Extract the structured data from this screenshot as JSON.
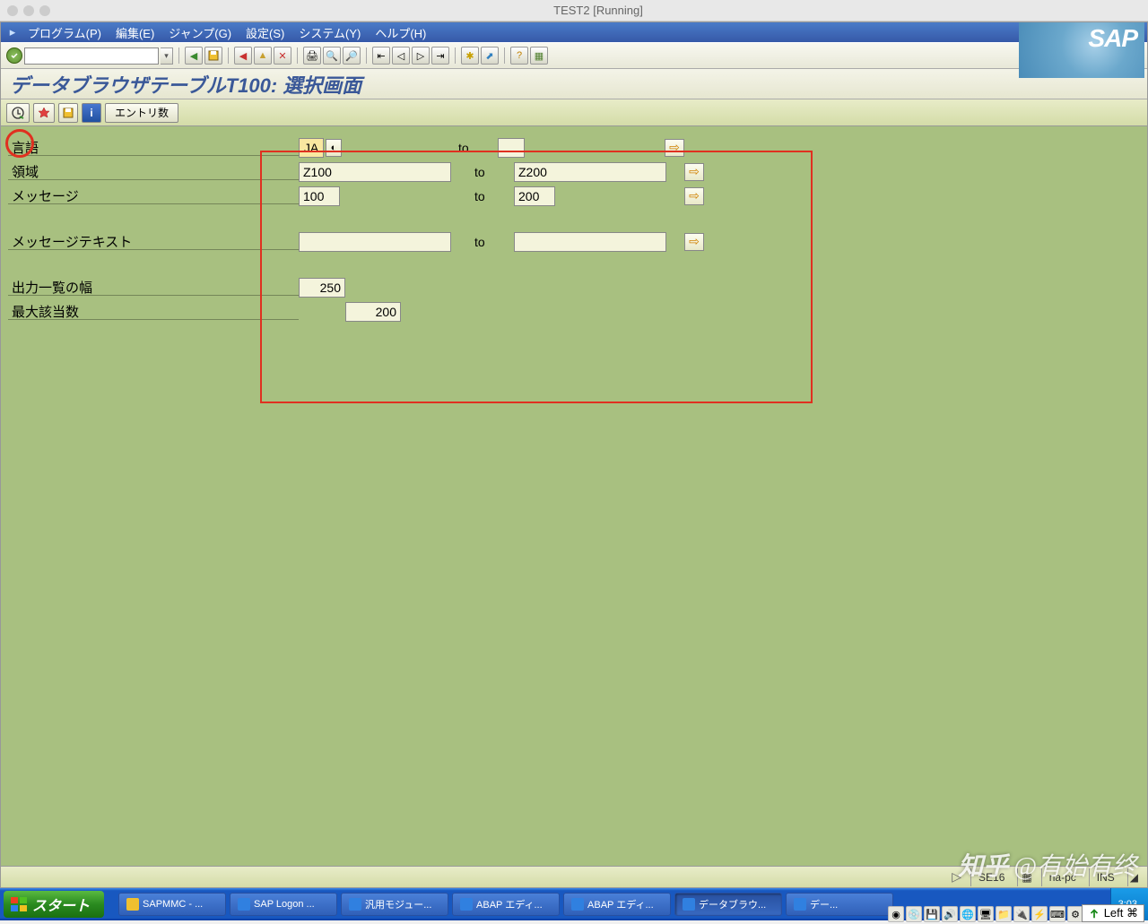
{
  "window": {
    "title": "TEST2 [Running]"
  },
  "menubar": {
    "items": [
      "プログラム(P)",
      "編集(E)",
      "ジャンプ(G)",
      "設定(S)",
      "システム(Y)",
      "ヘルプ(H)"
    ]
  },
  "sap_logo": "SAP",
  "page_title": "データブラウザテーブルT100: 選択画面",
  "app_toolbar": {
    "entry_count_btn": "エントリ数"
  },
  "selection": {
    "rows": [
      {
        "label": "言語",
        "from": "JA",
        "to": "",
        "has_f4": true,
        "from_class": "ja"
      },
      {
        "label": "領域",
        "from": "Z100",
        "to": "Z200",
        "has_f4": false
      },
      {
        "label": "メッセージ",
        "from": "100",
        "to": "200",
        "has_f4": false
      }
    ],
    "text_row": {
      "label": "メッセージテキスト",
      "from": "",
      "to": ""
    },
    "width_row": {
      "label": "出力一覧の幅",
      "value": "250"
    },
    "max_row": {
      "label": "最大該当数",
      "value": "200"
    },
    "to_label": "to"
  },
  "status_bar": {
    "tcode": "SE16",
    "host": "na-pc",
    "mode": "INS"
  },
  "taskbar": {
    "start": "スタート",
    "items": [
      {
        "label": "SAPMMC - ...",
        "color": "#f0c030"
      },
      {
        "label": "SAP Logon ...",
        "color": "#3080e0"
      },
      {
        "label": "汎用モジュー...",
        "color": "#3080e0"
      },
      {
        "label": "ABAP エディ...",
        "color": "#3080e0"
      },
      {
        "label": "ABAP エディ...",
        "color": "#3080e0"
      },
      {
        "label": "データブラウ...",
        "color": "#3080e0",
        "active": true
      },
      {
        "label": "デー...",
        "color": "#3080e0"
      }
    ],
    "clock": "3:03"
  },
  "watermark": "知乎 @有始有终",
  "pointer_badge": "Left ⌘"
}
